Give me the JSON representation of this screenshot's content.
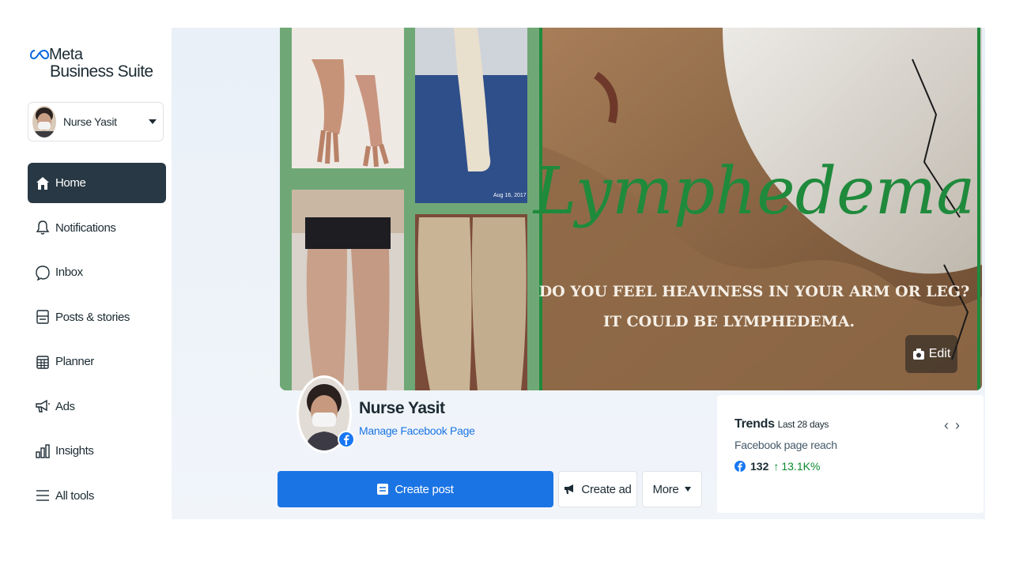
{
  "brand": {
    "line1": "Meta",
    "line2": "Business Suite"
  },
  "account": {
    "name": "Nurse Yasit"
  },
  "nav": [
    {
      "label": "Home",
      "icon": "home-icon",
      "active": true
    },
    {
      "label": "Notifications",
      "icon": "bell-icon"
    },
    {
      "label": "Inbox",
      "icon": "chat-bubble-icon"
    },
    {
      "label": "Posts & stories",
      "icon": "posts-icon"
    },
    {
      "label": "Planner",
      "icon": "calendar-icon"
    },
    {
      "label": "Ads",
      "icon": "megaphone-icon"
    },
    {
      "label": "Insights",
      "icon": "bar-chart-icon"
    },
    {
      "label": "All tools",
      "icon": "menu-icon"
    }
  ],
  "cover": {
    "date_stamp": "Aug 16, 2017",
    "script_title": "Lymphedema",
    "headline_line1": "DO YOU FEEL HEAVINESS IN YOUR ARM OR LEG?",
    "headline_line2": "IT COULD BE LYMPHEDEMA.",
    "edit_label": "Edit"
  },
  "page": {
    "name": "Nurse Yasit",
    "manage_link": "Manage Facebook Page"
  },
  "actions": {
    "create_post": "Create post",
    "create_ad": "Create ad",
    "more": "More"
  },
  "trends": {
    "title": "Trends",
    "period": "Last 28 days",
    "metric": "Facebook page reach",
    "value": "132",
    "change": "13.1K%",
    "change_color": "#0a8a2e"
  },
  "colors": {
    "accent": "#1b74e4",
    "nav_active": "#283844",
    "cover_green": "#1f8a3c"
  }
}
